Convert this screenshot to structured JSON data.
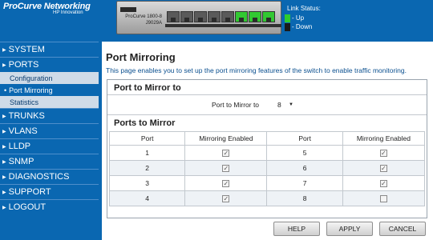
{
  "brand": {
    "name": "ProCurve Networking",
    "sub": "HP Innovation"
  },
  "device": {
    "model": "ProCurve 1800-8",
    "part": "J9029A",
    "ports": [
      {
        "status": "down"
      },
      {
        "status": "down"
      },
      {
        "status": "down"
      },
      {
        "status": "down"
      },
      {
        "status": "down"
      },
      {
        "status": "up"
      },
      {
        "status": "up"
      },
      {
        "status": "up"
      }
    ]
  },
  "link_status": {
    "title": "Link Status:",
    "up_label": "- Up",
    "down_label": "- Down",
    "up_color": "#2ecc2e",
    "down_color": "#1a1a1a"
  },
  "sidebar": {
    "items": [
      {
        "label": "SYSTEM"
      },
      {
        "label": "PORTS"
      },
      {
        "label": "TRUNKS"
      },
      {
        "label": "VLANS"
      },
      {
        "label": "LLDP"
      },
      {
        "label": "SNMP"
      },
      {
        "label": "DIAGNOSTICS"
      },
      {
        "label": "SUPPORT"
      },
      {
        "label": "LOGOUT"
      }
    ],
    "ports_sub": [
      {
        "label": "Configuration",
        "active": false
      },
      {
        "label": "Port Mirroring",
        "active": true
      },
      {
        "label": "Statistics",
        "active": false
      }
    ]
  },
  "main": {
    "title": "Port Mirroring",
    "description": "This page enables you to set up the port mirroring features of the switch to enable traffic monitoring.",
    "mirror_section_title": "Port to Mirror to",
    "mirror_label": "Port to Mirror to",
    "mirror_value": "8",
    "ports_section_title": "Ports to Mirror",
    "columns": [
      "Port",
      "Mirroring Enabled",
      "Port",
      "Mirroring Enabled"
    ],
    "rows": [
      {
        "left_port": "1",
        "left_enabled": true,
        "right_port": "5",
        "right_enabled": true
      },
      {
        "left_port": "2",
        "left_enabled": true,
        "right_port": "6",
        "right_enabled": true
      },
      {
        "left_port": "3",
        "left_enabled": true,
        "right_port": "7",
        "right_enabled": true
      },
      {
        "left_port": "4",
        "left_enabled": true,
        "right_port": "8",
        "right_enabled": false
      }
    ]
  },
  "buttons": {
    "help": "HELP",
    "apply": "APPLY",
    "cancel": "CANCEL"
  },
  "colors": {
    "accent": "#0a67b1"
  }
}
